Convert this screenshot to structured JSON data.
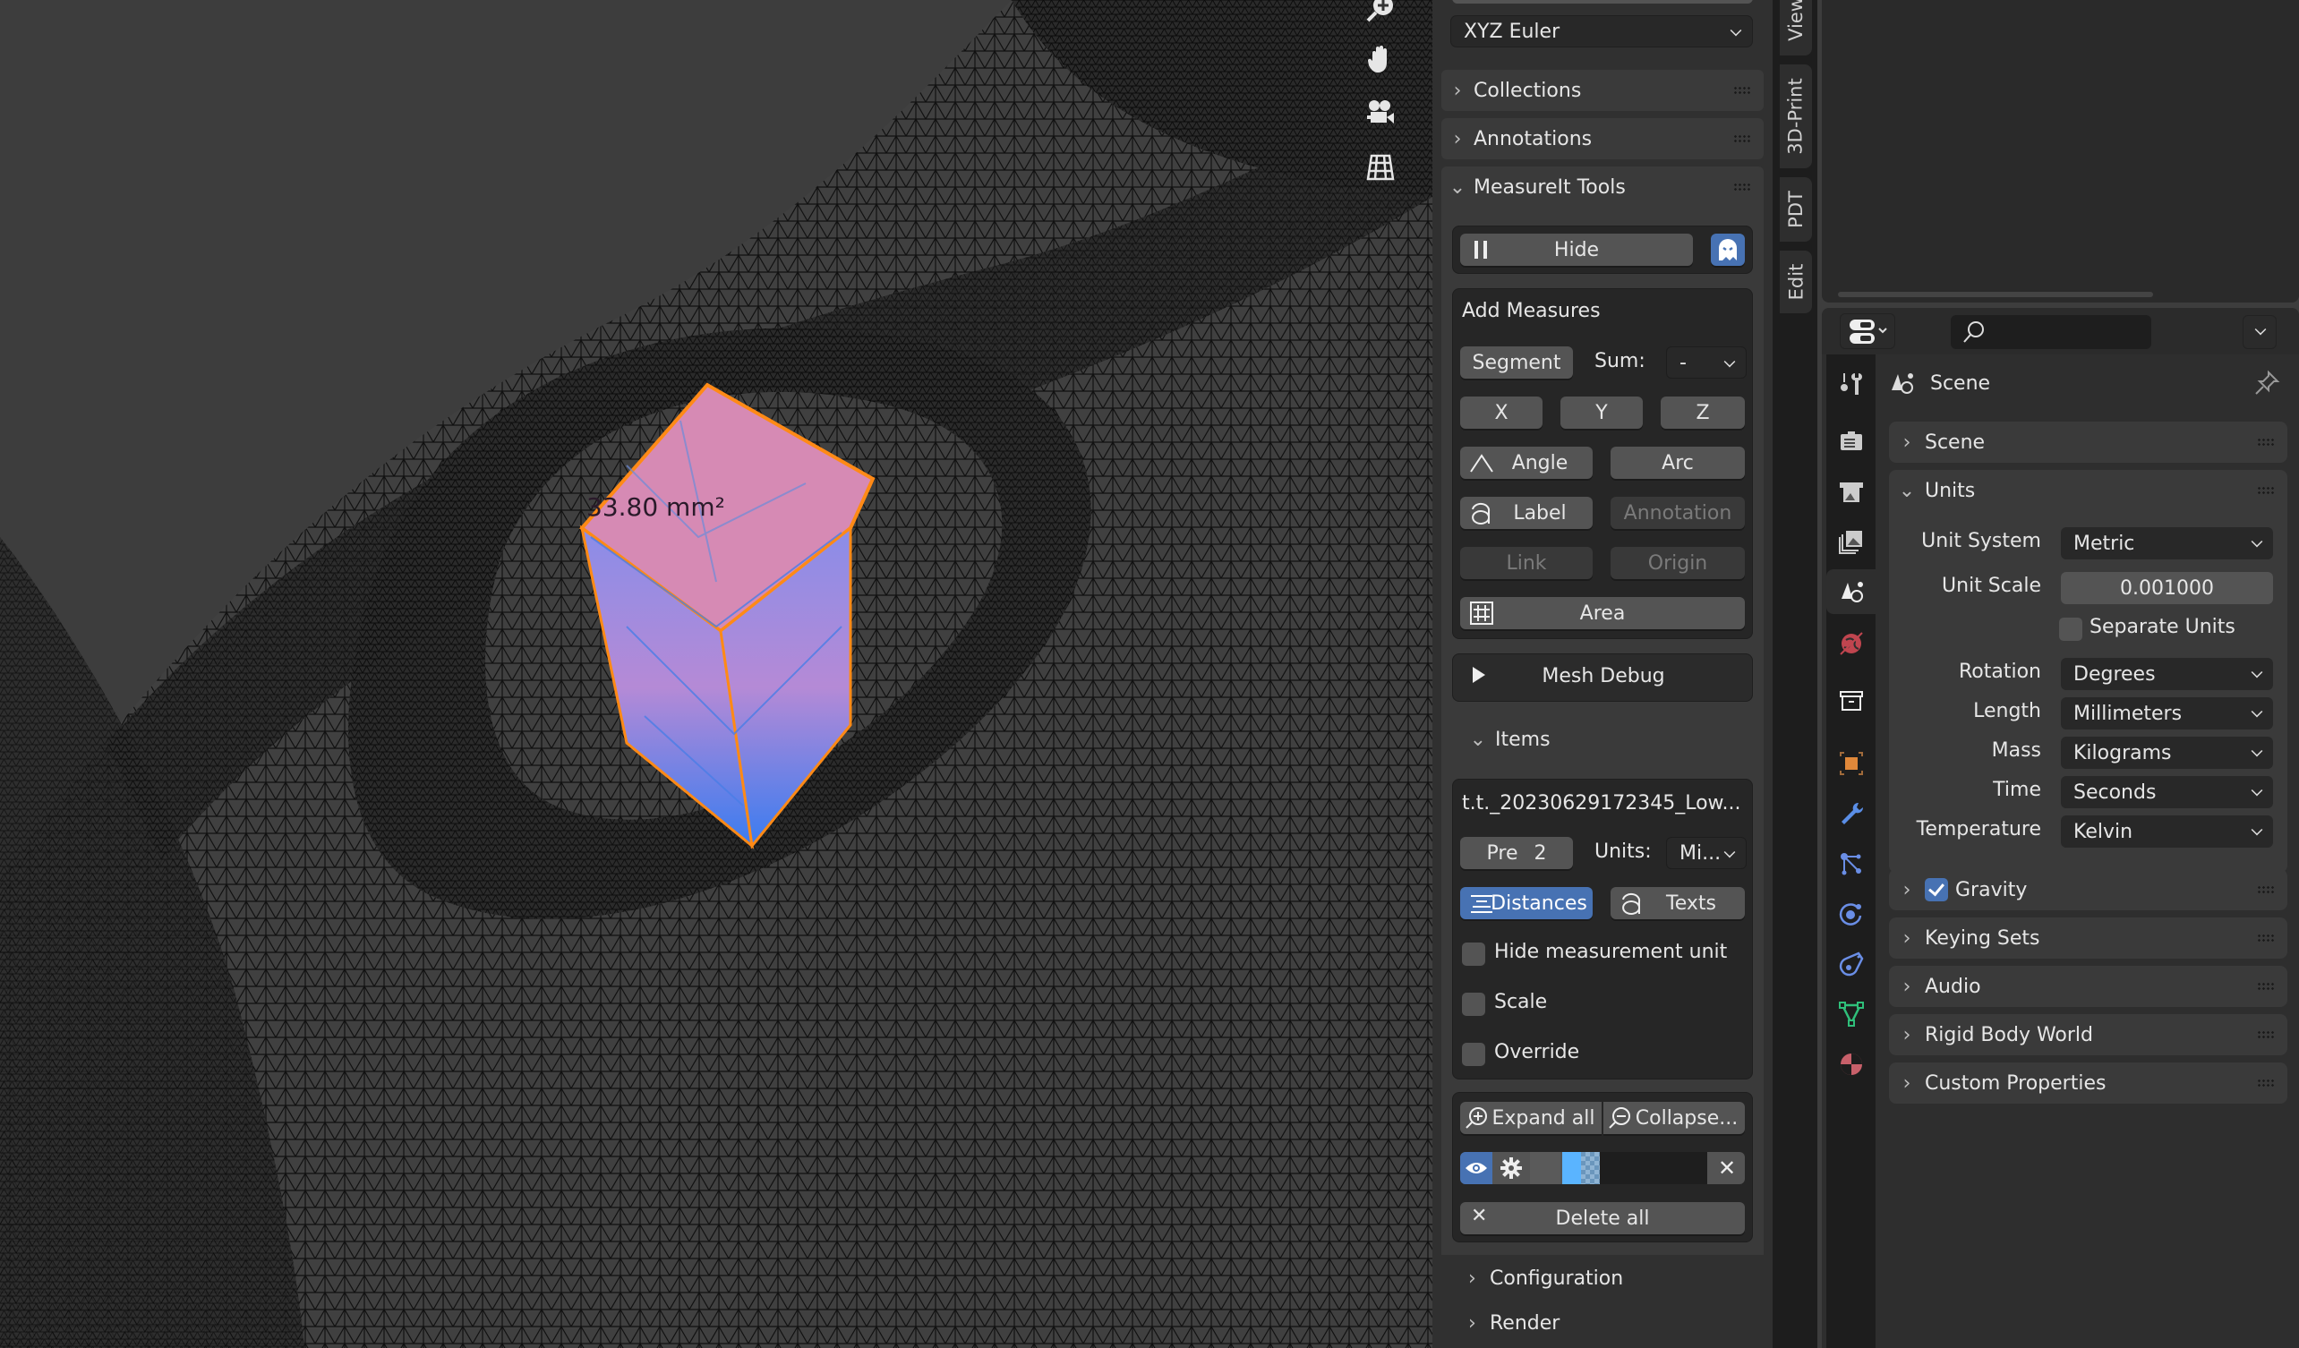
{
  "viewport": {
    "measurement_label": "33.80 mm²",
    "nav_gizmos": [
      {
        "name": "zoom-icon"
      },
      {
        "name": "hand-pan-icon"
      },
      {
        "name": "camera-view-icon"
      },
      {
        "name": "orthographic-grid-icon"
      }
    ],
    "colors": {
      "background": "#3d3d3d",
      "mesh_lines": "#111111",
      "selection_top": "#d88cb3",
      "selection_side": "#5b7fe6",
      "selection_outline": "#ff8c1a"
    }
  },
  "npanel": {
    "rotation_mode": "XYZ Euler",
    "sections": {
      "collections": "Collections",
      "annotations": "Annotations",
      "measureit": "MeasureIt Tools"
    },
    "hide_button": "Hide",
    "add_measures": {
      "title": "Add Measures",
      "segment": "Segment",
      "sum_label": "Sum:",
      "sum_value": "-",
      "x": "X",
      "y": "Y",
      "z": "Z",
      "angle": "Angle",
      "arc": "Arc",
      "label": "Label",
      "annotation": "Annotation",
      "link": "Link",
      "origin": "Origin",
      "area": "Area"
    },
    "mesh_debug": "Mesh Debug",
    "items": {
      "header": "Items",
      "object_name": "t.t._20230629172345_Low...",
      "precision_label": "Pre",
      "precision_value": "2",
      "units_label": "Units:",
      "units_value": "Mi...",
      "distances": "Distances",
      "texts": "Texts",
      "checkboxes": [
        {
          "label": "Hide measurement unit",
          "checked": false
        },
        {
          "label": "Scale",
          "checked": false
        },
        {
          "label": "Override",
          "checked": false
        }
      ],
      "expand_all": "Expand all",
      "collapse_all": "Collapse...",
      "delete_all": "Delete all",
      "color_swatch": "#5ab4ff"
    },
    "configuration": "Configuration",
    "render": "Render"
  },
  "vertical_tabs": [
    "View",
    "3D-Print",
    "PDT",
    "Edit"
  ],
  "properties": {
    "context_title": "Scene",
    "search_placeholder": "",
    "tabs": [
      {
        "name": "tool-icon",
        "active": false
      },
      {
        "name": "render-icon",
        "active": false
      },
      {
        "name": "output-icon",
        "active": false
      },
      {
        "name": "view-layer-icon",
        "active": false
      },
      {
        "name": "scene-icon",
        "active": true
      },
      {
        "name": "world-icon",
        "active": false
      },
      {
        "name": "collection-icon",
        "active": false
      },
      {
        "name": "object-icon",
        "active": false
      },
      {
        "name": "modifier-icon",
        "active": false
      },
      {
        "name": "particles-icon",
        "active": false
      },
      {
        "name": "physics-icon",
        "active": false
      },
      {
        "name": "constraints-icon",
        "active": false
      },
      {
        "name": "data-icon",
        "active": false
      },
      {
        "name": "material-icon",
        "active": false
      }
    ],
    "panels": {
      "scene": "Scene",
      "units": "Units",
      "gravity": "Gravity",
      "gravity_checked": true,
      "keying_sets": "Keying Sets",
      "audio": "Audio",
      "rigid_body_world": "Rigid Body World",
      "custom_properties": "Custom Properties"
    },
    "units": {
      "unit_system_label": "Unit System",
      "unit_system": "Metric",
      "unit_scale_label": "Unit Scale",
      "unit_scale": "0.001000",
      "separate_units_label": "Separate Units",
      "separate_units": false,
      "rotation_label": "Rotation",
      "rotation": "Degrees",
      "length_label": "Length",
      "length": "Millimeters",
      "mass_label": "Mass",
      "mass": "Kilograms",
      "time_label": "Time",
      "time": "Seconds",
      "temperature_label": "Temperature",
      "temperature": "Kelvin"
    }
  }
}
